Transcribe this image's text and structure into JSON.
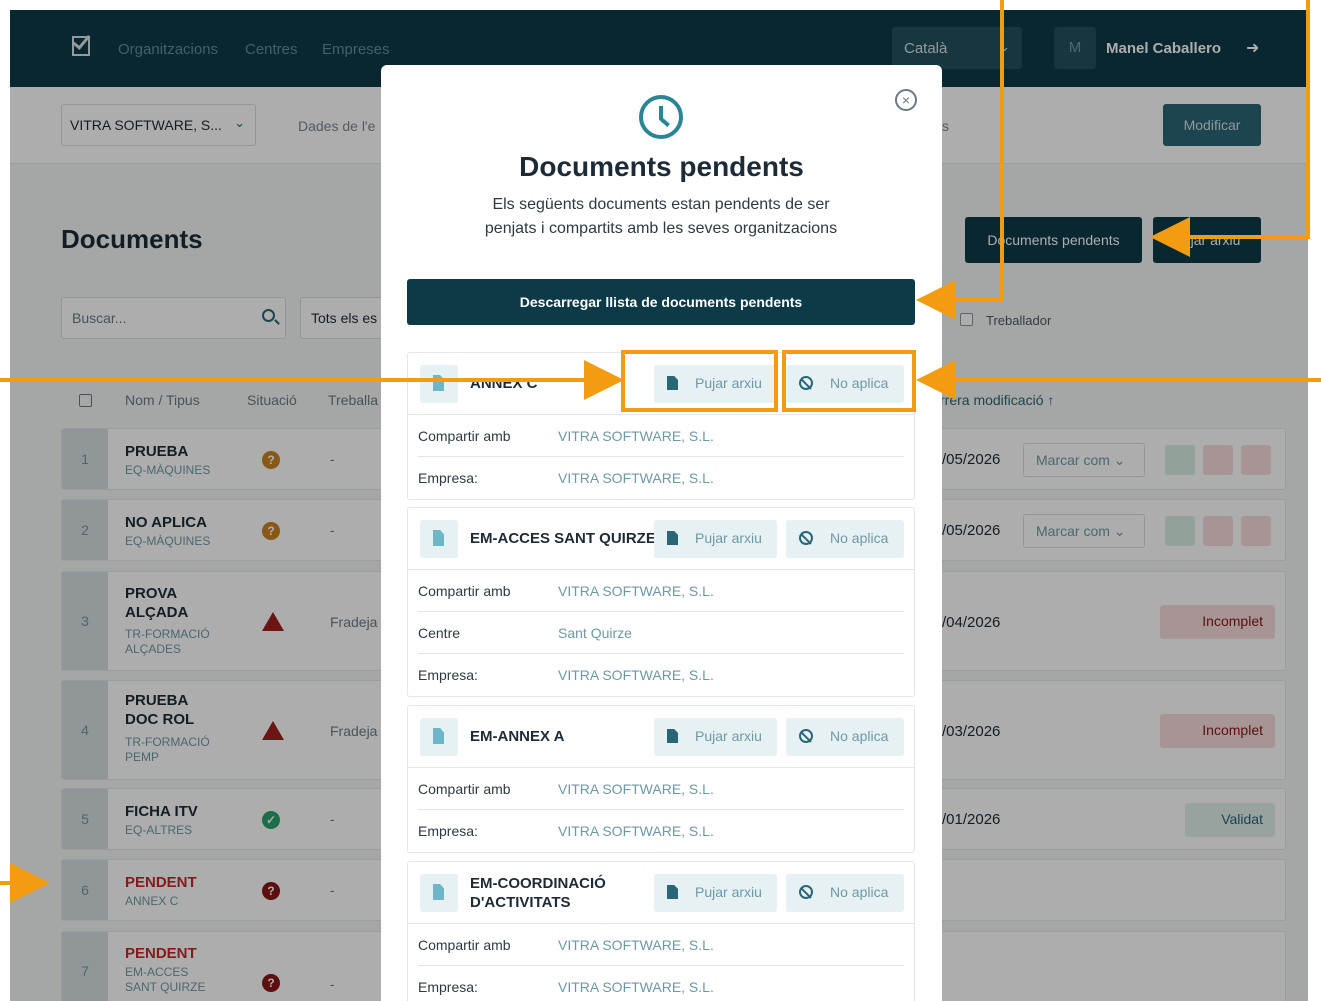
{
  "nav": {
    "links": [
      "Organitzacions",
      "Centres",
      "Empreses"
    ],
    "language": "Català",
    "avatar_letter": "M",
    "user_name": "Manel Caballero",
    "logout_icon": "logout-icon"
  },
  "subbar": {
    "company": "VITRA SOFTWARE, S...",
    "tab_partial_left": "Dades de l'e",
    "tab_partial_right": "s",
    "modify_label": "Modificar"
  },
  "page": {
    "title": "Documents",
    "pending_button": "Documents pendents",
    "upload_button": "Pujar arxiu",
    "search_placeholder": "Buscar...",
    "filter_value": "Tots els es",
    "worker_checkbox_label": "Treballador",
    "columns": [
      "Nom / Tipus",
      "Situació",
      "Treballa",
      "rrera modificació ↑"
    ]
  },
  "rows": [
    {
      "num": "1",
      "name": "PRUEBA",
      "type": "EQ-MÀQUINES",
      "worker": "-",
      "date": "/05/2026",
      "mark": "Marcar com",
      "status": "orange"
    },
    {
      "num": "2",
      "name": "NO APLICA",
      "type": "EQ-MÀQUINES",
      "worker": "-",
      "date": "/05/2026",
      "mark": "Marcar com",
      "status": "orange"
    },
    {
      "num": "3",
      "name": "PROVA ALÇADA",
      "type": "TR-FORMACIÓ ALÇADES",
      "worker": "Fradeja",
      "date": "/04/2026",
      "badge": "Incomplet",
      "status": "warn"
    },
    {
      "num": "4",
      "name": "PRUEBA DOC ROL",
      "type": "TR-FORMACIÓ PEMP",
      "worker": "Fradeja",
      "date": "/03/2026",
      "badge": "Incomplet",
      "status": "warn"
    },
    {
      "num": "5",
      "name": "FICHA ITV",
      "type": "EQ-ALTRES",
      "worker": "-",
      "date": "/01/2026",
      "badge": "Validat",
      "status": "green"
    },
    {
      "num": "6",
      "name": "PENDENT",
      "type": "ANNEX C",
      "worker": "-",
      "status": "darkred"
    },
    {
      "num": "7",
      "name": "PENDENT",
      "type": "EM-ACCES SANT QUIRZE",
      "worker": "-",
      "status": "darkred"
    }
  ],
  "modal": {
    "title": "Documents pendents",
    "subtitle": "Els següents documents estan pendents de ser penjats i compartits amb les seves organitzacions",
    "download_button": "Descarregar llista de documents pendents",
    "upload_label": "Pujar arxiu",
    "not_applicable_label": "No aplica",
    "cards": [
      {
        "name": "ANNEX C",
        "fields": [
          {
            "k": "Compartir amb",
            "v": "VITRA SOFTWARE, S.L."
          },
          {
            "k": "Empresa:",
            "v": "VITRA SOFTWARE, S.L."
          }
        ]
      },
      {
        "name": "EM-ACCES SANT QUIRZE",
        "fields": [
          {
            "k": "Compartir amb",
            "v": "VITRA SOFTWARE, S.L."
          },
          {
            "k": "Centre",
            "v": "Sant Quirze"
          },
          {
            "k": "Empresa:",
            "v": "VITRA SOFTWARE, S.L."
          }
        ]
      },
      {
        "name": "EM-ANNEX A",
        "fields": [
          {
            "k": "Compartir amb",
            "v": "VITRA SOFTWARE, S.L."
          },
          {
            "k": "Empresa:",
            "v": "VITRA SOFTWARE, S.L."
          }
        ]
      },
      {
        "name": "EM-COORDINACIÓ D'ACTIVITATS",
        "fields": [
          {
            "k": "Compartir amb",
            "v": "VITRA SOFTWARE, S.L."
          },
          {
            "k": "Empresa:",
            "v": "VITRA SOFTWARE, S.L."
          }
        ]
      }
    ]
  },
  "annotation_color": "#f39c12"
}
